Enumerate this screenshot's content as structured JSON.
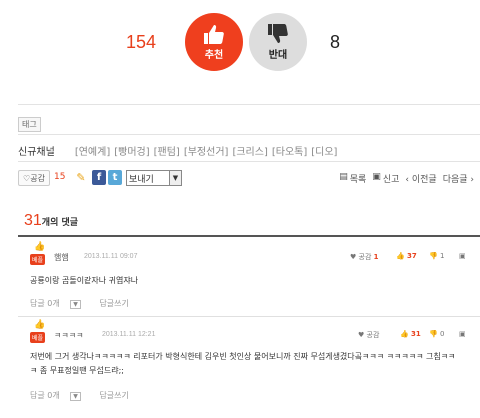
{
  "vote": {
    "up_count": "154",
    "up_label": "추천",
    "down_label": "반대",
    "down_count": "8"
  },
  "tag": {
    "label": "태그"
  },
  "channel": {
    "title": "신규채널",
    "links": [
      "[연예계]",
      "[빵머겅]",
      "[팬텀]",
      "[부정선거]",
      "[크리스]",
      "[타오톡]",
      "[디오]"
    ]
  },
  "actions": {
    "like_label": "♡공감",
    "like_count": "15",
    "send_label": "보내기",
    "list_label": "목록",
    "report_label": "신고",
    "prev_label": "‹ 이전글",
    "next_label": "다음글 ›"
  },
  "comments": {
    "count": "31",
    "suffix": "개의 댓글",
    "items": [
      {
        "badge": "베플",
        "nick": "햄햄",
        "time": "2013.11.11 09:07",
        "like_label": "공감",
        "like_count": "1",
        "up_count": "37",
        "down_count": "1",
        "body": "공룡이랑 곰돌이같자나 귀엽쟈나",
        "reply_label": "답글 0개",
        "write_label": "답글쓰기"
      },
      {
        "badge": "베플",
        "nick": "ㅋㅋㅋㅋ",
        "time": "2013.11.11 12:21",
        "like_label": "공감",
        "like_count": "",
        "up_count": "31",
        "down_count": "0",
        "body": "저번에 그거 생각나ㅋㅋㅋㅋㅋ 리포터가 박형식한테 김우빈 첫인상 물어보니까 진짜 무섭게생겼다곸ㅋㅋㅋ ㅋㅋㅋㅋㅋ 그침ㅋㅋㅋ 좀 무표정일땐 무섭드랴;;",
        "reply_label": "답글 0개",
        "write_label": "답글쓰기"
      }
    ]
  }
}
